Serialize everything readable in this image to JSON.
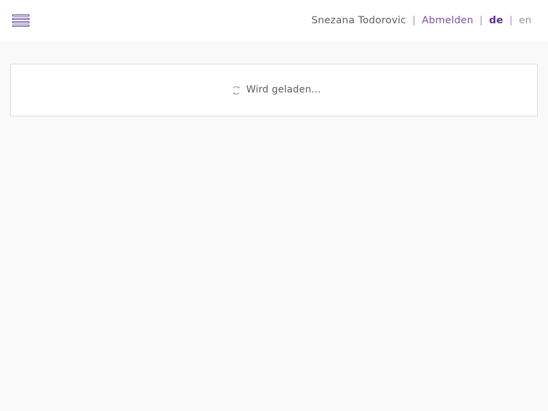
{
  "header": {
    "menu_icon": "hamburger-menu-icon",
    "user_name": "Snezana Todorovic",
    "separator": "|",
    "logout_label": "Abmelden",
    "languages": {
      "de": "de",
      "en": "en",
      "active": "de"
    }
  },
  "main": {
    "loading_icon": "spinner-icon",
    "loading_text": "Wird geladen..."
  },
  "colors": {
    "accent": "#5b2e91",
    "link": "#7a52a8",
    "background": "#f9f9f9",
    "panel": "#ffffff"
  }
}
